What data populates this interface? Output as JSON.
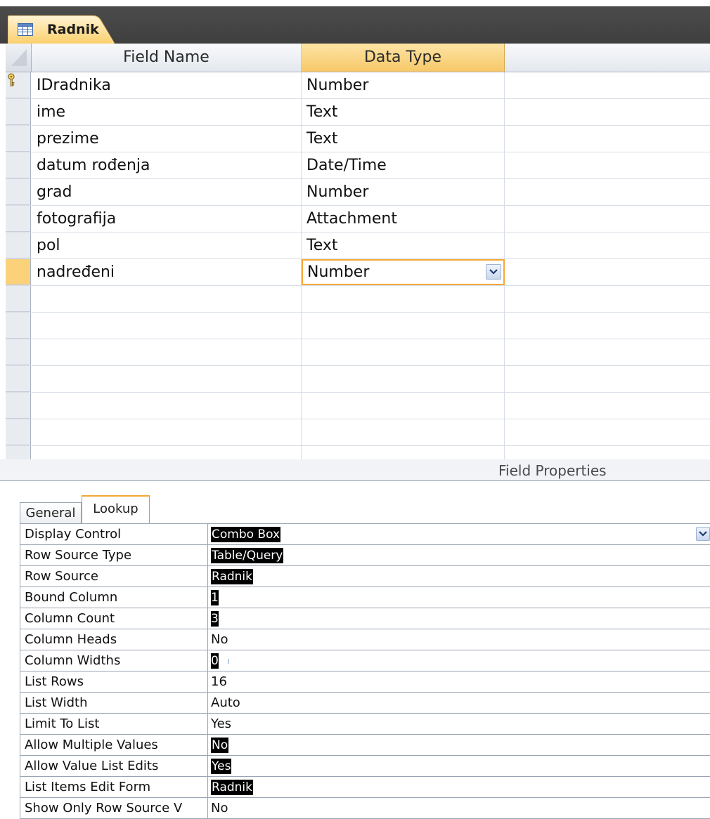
{
  "document_tab": {
    "title": "Radnik",
    "icon": "table-icon"
  },
  "grid": {
    "headers": {
      "field_name": "Field Name",
      "data_type": "Data Type"
    },
    "rows": [
      {
        "field_name": "IDradnika",
        "data_type": "Number",
        "primary_key": true
      },
      {
        "field_name": "ime",
        "data_type": "Text"
      },
      {
        "field_name": "prezime",
        "data_type": "Text"
      },
      {
        "field_name": "datum rođenja",
        "data_type": "Date/Time"
      },
      {
        "field_name": "grad",
        "data_type": "Number"
      },
      {
        "field_name": "fotografija",
        "data_type": "Attachment"
      },
      {
        "field_name": "pol",
        "data_type": "Text"
      },
      {
        "field_name": "nadređeni",
        "data_type": "Number",
        "current": true
      }
    ]
  },
  "field_properties": {
    "title": "Field Properties",
    "tabs": {
      "general": "General",
      "lookup": "Lookup"
    },
    "active_tab": "Lookup",
    "properties": [
      {
        "label": "Display Control",
        "value": "Combo Box",
        "highlight": true
      },
      {
        "label": "Row Source Type",
        "value": "Table/Query",
        "highlight": true
      },
      {
        "label": "Row Source",
        "value": "Radnik",
        "highlight": true
      },
      {
        "label": "Bound Column",
        "value": "1",
        "highlight": true
      },
      {
        "label": "Column Count",
        "value": "3",
        "highlight": true
      },
      {
        "label": "Column Heads",
        "value": "No",
        "highlight": false
      },
      {
        "label": "Column Widths",
        "value": "0",
        "highlight": true
      },
      {
        "label": "List Rows",
        "value": "16",
        "highlight": false
      },
      {
        "label": "List Width",
        "value": "Auto",
        "highlight": false
      },
      {
        "label": "Limit To List",
        "value": "Yes",
        "highlight": false
      },
      {
        "label": "Allow Multiple Values",
        "value": "No",
        "highlight": true
      },
      {
        "label": "Allow Value List Edits",
        "value": "Yes",
        "highlight": true
      },
      {
        "label": "List Items Edit Form",
        "value": "Radnik",
        "highlight": true
      },
      {
        "label": "Show Only Row Source V",
        "value": "No",
        "highlight": false
      }
    ]
  },
  "colors": {
    "accent_orange": "#f6a83b",
    "header_active": "#f7c868",
    "selector_current": "#fbd17a",
    "highlight_bg": "#000000"
  }
}
